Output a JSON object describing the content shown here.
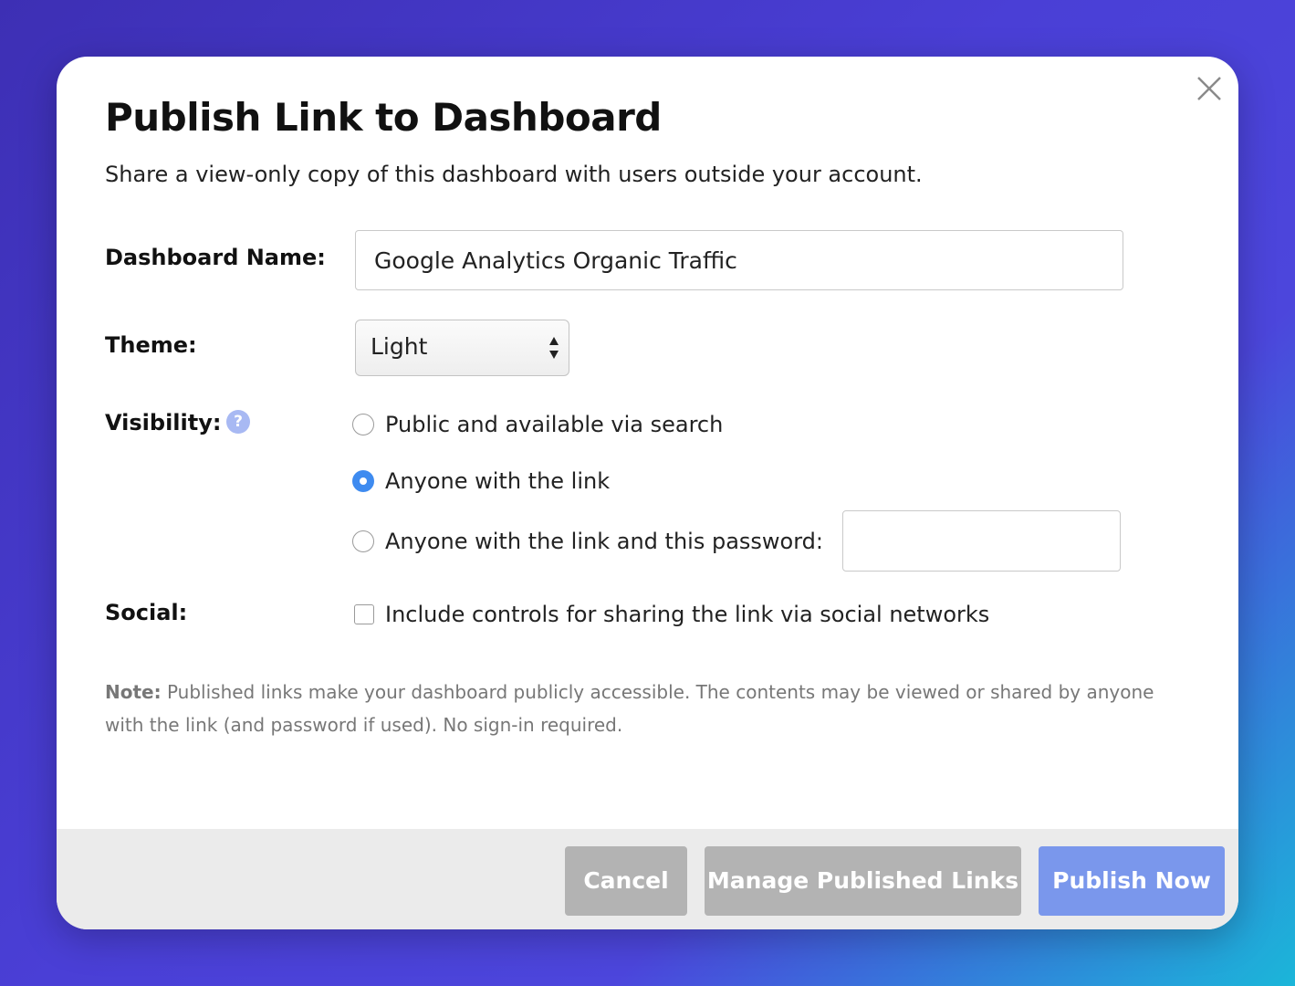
{
  "dialog": {
    "title": "Publish Link to Dashboard",
    "subtitle": "Share a view-only copy of this dashboard with users outside your account."
  },
  "form": {
    "dashboard_name_label": "Dashboard Name:",
    "dashboard_name_value": "Google Analytics Organic Traffic",
    "theme_label": "Theme:",
    "theme_value": "Light",
    "visibility_label": "Visibility:",
    "help_glyph": "?",
    "visibility_options": [
      {
        "label": "Public and available via search",
        "checked": false
      },
      {
        "label": "Anyone with the link",
        "checked": true
      },
      {
        "label": "Anyone with the link and this password:",
        "checked": false
      }
    ],
    "password_value": "",
    "social_label": "Social:",
    "social_checkbox_label": "Include controls for sharing the link via social networks",
    "social_checked": false
  },
  "note": {
    "prefix": "Note:",
    "text": " Published links make your dashboard publicly accessible. The contents may be viewed or shared by anyone with the link (and password if used). No sign-in required."
  },
  "footer": {
    "cancel_label": "Cancel",
    "manage_label": "Manage Published Links",
    "publish_label": "Publish Now"
  },
  "colors": {
    "radio_checked": "#3e8bf0",
    "publish_button": "#7a97ec",
    "secondary_button": "#b3b3b3",
    "help_icon": "#a8b9f3"
  },
  "icons": {
    "close": "close-icon",
    "help": "question-mark-icon",
    "select_arrows": "up-down-arrows-icon"
  }
}
